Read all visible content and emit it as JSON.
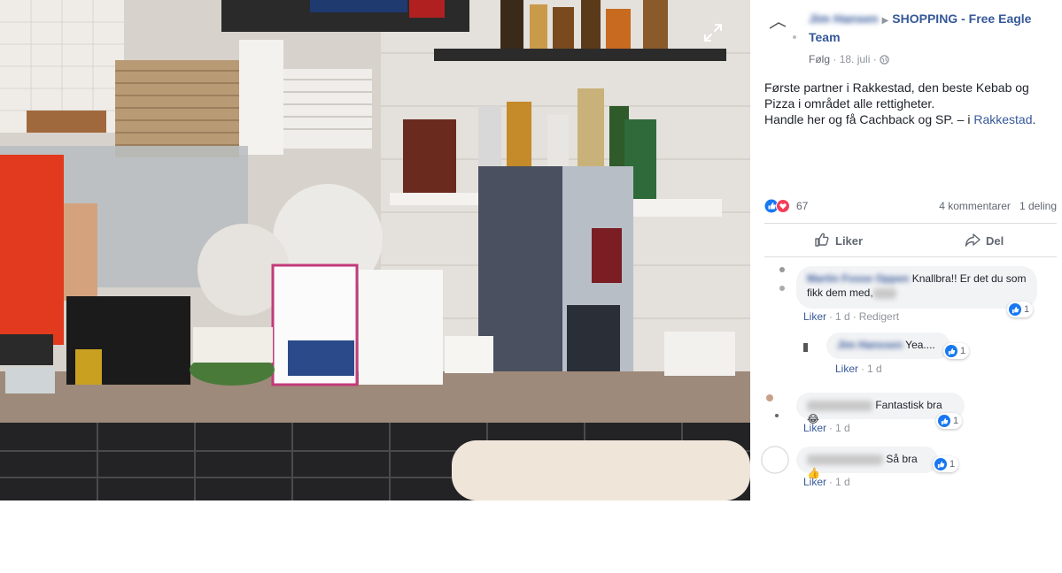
{
  "post": {
    "author": "Jim Hansen",
    "group": "SHOPPING - Free Eagle Team",
    "follow_label": "Følg",
    "date": "18. juli",
    "text_line1": "Første partner i Rakkestad, den beste Kebab og Pizza i området alle rettigheter.",
    "text_line2_prefix": "Handle her og få Cachback og SP. – i ",
    "place": "Rakkestad",
    "text_suffix": "."
  },
  "reactions": {
    "count": "67",
    "comments": "4 kommentarer",
    "shares": "1 deling"
  },
  "actions": {
    "like_label": "Liker",
    "share_label": "Del"
  },
  "comments": [
    {
      "name": "Martin Fosse Oppen",
      "text": "Knallbra!! Er det du som fikk dem med,",
      "text_tail": " Jim?",
      "like_count": "1",
      "like_link": "Liker",
      "time": "1 d",
      "edited": "Redigert"
    },
    {
      "name": "Jim Hanssen",
      "text": "Yea....",
      "like_count": "1",
      "like_link": "Liker",
      "time": "1 d"
    },
    {
      "name": "Commenter",
      "text": "Fantastisk bra😂",
      "like_count": "1",
      "like_link": "Liker",
      "time": "1 d"
    },
    {
      "name": "Commenter",
      "text": "Så bra👍",
      "like_count": "1",
      "like_link": "Liker",
      "time": "1 d"
    }
  ],
  "icons": {
    "expand": "expand-icon",
    "globe": "globe-icon",
    "thumbs_up": "thumbs-up-icon",
    "share": "share-arrow-icon",
    "heart": "heart-icon"
  },
  "colors": {
    "link": "#365899",
    "like_blue": "#1877f2",
    "love_red": "#f33e58",
    "muted": "#90949c",
    "bubble": "#f2f3f5"
  }
}
